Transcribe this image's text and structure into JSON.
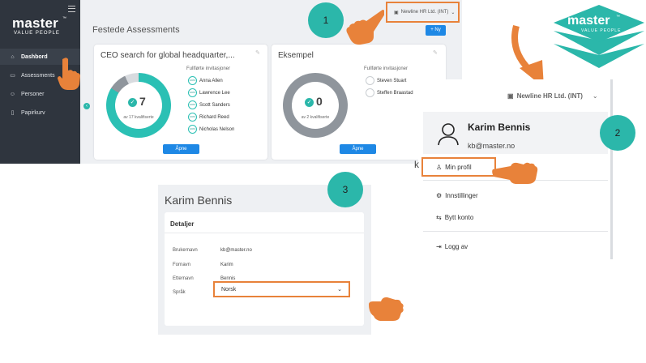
{
  "app": {
    "logo_text": "master",
    "logo_tm": "™",
    "logo_sub": "VALUE PEOPLE",
    "sidebar": [
      {
        "label": "Dashbord",
        "icon": "home-icon"
      },
      {
        "label": "Assessments",
        "icon": "book-icon"
      },
      {
        "label": "Personer",
        "icon": "users-icon"
      },
      {
        "label": "Papirkurv",
        "icon": "trash-icon"
      }
    ],
    "section_title": "Festede Assessments",
    "company": "Newline HR Ltd. (INT)",
    "add_button": "+ Ny",
    "cards": [
      {
        "title": "CEO search for global headquarter,...",
        "value": "7",
        "subtitle": "av 17 kvalifiserte",
        "progress": 0.84,
        "invites_title": "Fullførte invitasjoner",
        "invitees": [
          {
            "name": "Anna Allen",
            "badge": "100%"
          },
          {
            "name": "Lawrence Lee",
            "badge": "100%"
          },
          {
            "name": "Scott Sanders",
            "badge": "100%"
          },
          {
            "name": "Richard Reed",
            "badge": "100%"
          },
          {
            "name": "Nicholas Nelson",
            "badge": "100%"
          }
        ],
        "button": "Åpne"
      },
      {
        "title": "Eksempel",
        "value": "0",
        "subtitle": "av 2 kvalifiserte",
        "progress": 0,
        "invites_title": "Fullførte invitasjoner",
        "invitees": [
          {
            "name": "Steven Stuart",
            "badge": ""
          },
          {
            "name": "Steffen Braastad",
            "badge": ""
          }
        ],
        "button": "Åpne"
      }
    ]
  },
  "brand": {
    "text": "master",
    "tm": "™",
    "sub": "VALUE PEOPLE"
  },
  "steps": [
    "1",
    "2",
    "3"
  ],
  "menu": {
    "company": "Newline HR Ltd. (INT)",
    "user_name": "Karim Bennis",
    "user_email": "kb@master.no",
    "items": [
      "Min profil",
      "Innstillinger",
      "Bytt konto",
      "Logg av"
    ],
    "cut_text": "k"
  },
  "profile": {
    "title": "Karim Bennis",
    "section": "Detaljer",
    "fields": [
      {
        "label": "Brukernavn",
        "value": "kb@master.no"
      },
      {
        "label": "Fornavn",
        "value": "Karim"
      },
      {
        "label": "Etternavn",
        "value": "Bennis"
      }
    ],
    "language_label": "Språk",
    "language_value": "Norsk"
  },
  "colors": {
    "teal": "#2bb7aa",
    "orange": "#e8823a",
    "blue": "#1e88e5",
    "sidebar": "#2f353e"
  }
}
